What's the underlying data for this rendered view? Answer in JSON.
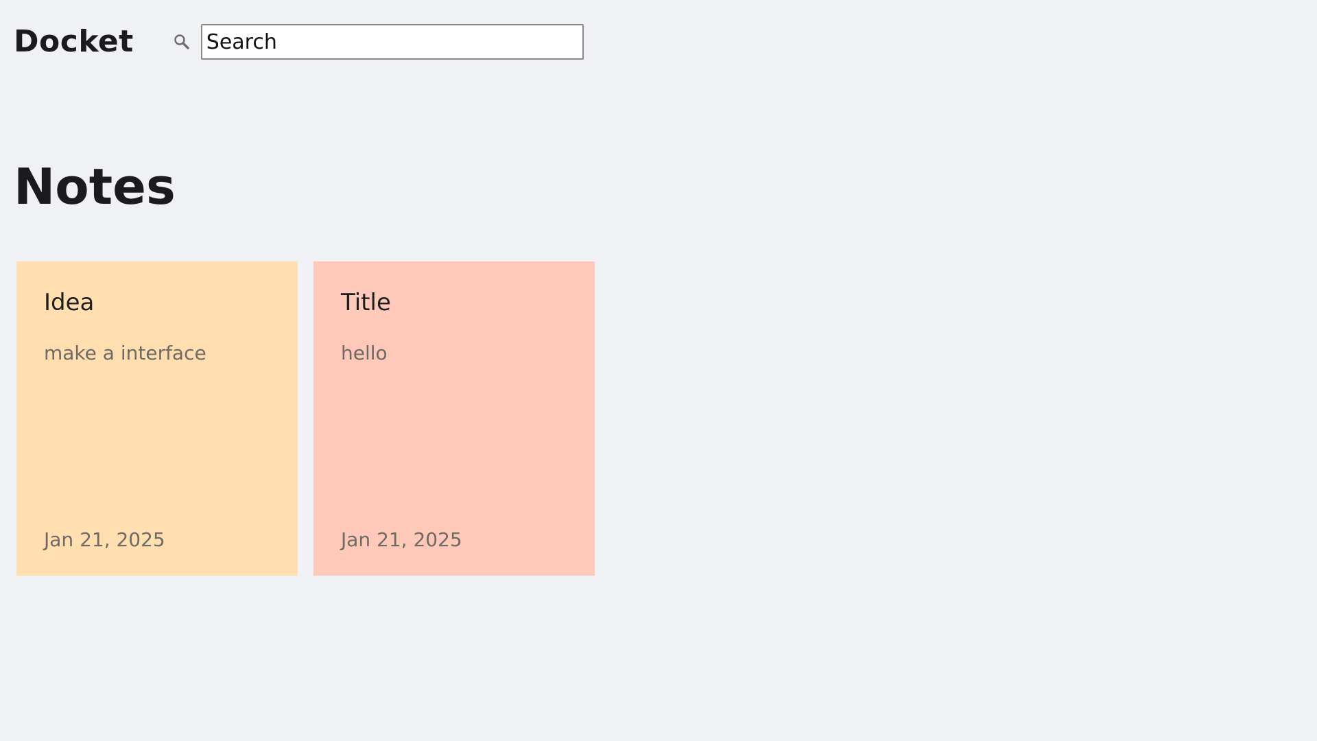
{
  "app": {
    "brand": "Docket"
  },
  "search": {
    "placeholder": "Search",
    "value": "",
    "icon": "search-icon"
  },
  "main": {
    "title": "Notes",
    "notes": [
      {
        "title": "Idea",
        "body": "make a interface",
        "date": "Jan 21, 2025",
        "color": "#ffdeb0"
      },
      {
        "title": "Title",
        "body": "hello",
        "date": "Jan 21, 2025",
        "color": "#ffc9b9"
      }
    ]
  },
  "colors": {
    "background": "#f0f1f5",
    "text": "#1b1b1f",
    "muted_text": "#6e6a66"
  }
}
